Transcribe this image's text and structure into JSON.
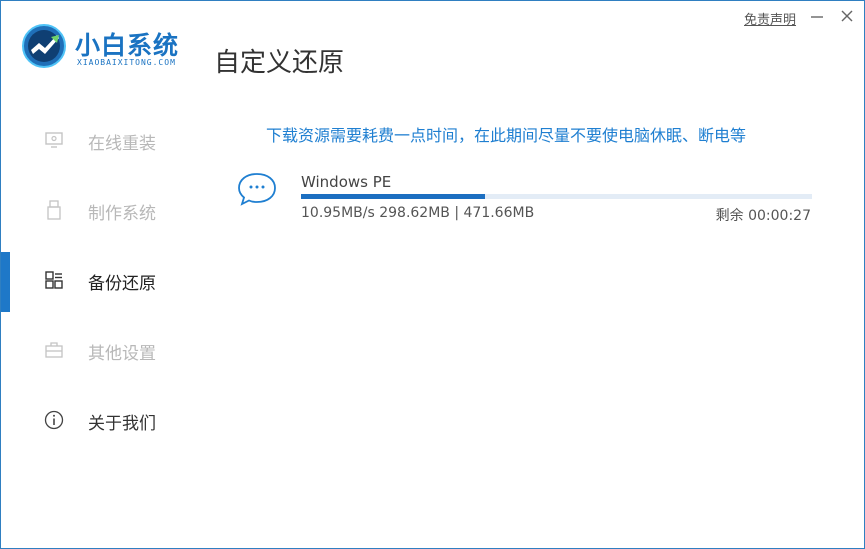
{
  "app": {
    "name": "小白系统",
    "sub_name": "XIAOBAIXITONG.COM",
    "page_title": "自定义还原"
  },
  "titlebar": {
    "disclaimer": "免责声明",
    "minimize_icon": "minimize-icon",
    "close_icon": "close-icon"
  },
  "sidebar": {
    "items": [
      {
        "label": "在线重装",
        "icon": "monitor-icon",
        "active": false
      },
      {
        "label": "制作系统",
        "icon": "usb-icon",
        "active": false
      },
      {
        "label": "备份还原",
        "icon": "grid-icon",
        "active": true
      },
      {
        "label": "其他设置",
        "icon": "briefcase-icon",
        "active": false
      },
      {
        "label": "关于我们",
        "icon": "info-icon",
        "active": false
      }
    ]
  },
  "main": {
    "notice": "下载资源需要耗费一点时间，在此期间尽量不要使电脑休眠、断电等",
    "task": {
      "icon": "chat-face-icon",
      "name": "Windows PE",
      "progress": 0.36,
      "stats": "10.95MB/s 298.62MB | 471.66MB",
      "remaining": "剩余 00:00:27"
    }
  },
  "colors": {
    "accent": "#1e78c8",
    "notice": "#1f7fd1",
    "progress_track": "#e3ecf6",
    "inactive_text": "#b8b8b8"
  }
}
